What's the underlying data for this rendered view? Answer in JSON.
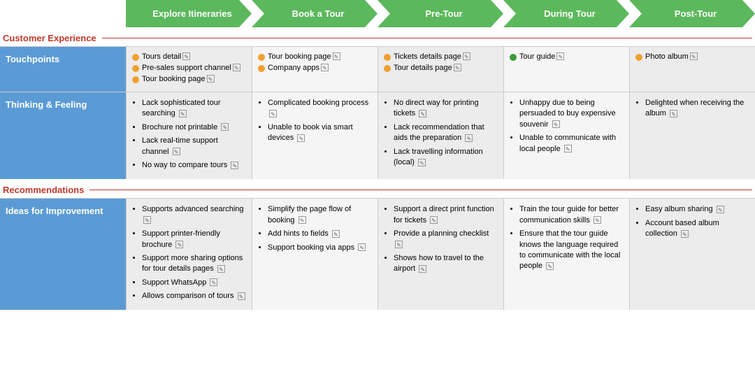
{
  "header": {
    "phases": [
      {
        "label": "Explore Itineraries"
      },
      {
        "label": "Book a Tour"
      },
      {
        "label": "Pre-Tour"
      },
      {
        "label": "During Tour"
      },
      {
        "label": "Post-Tour"
      }
    ]
  },
  "sections": {
    "customer_experience_label": "Customer Experience",
    "recommendations_label": "Recommendations"
  },
  "rows": [
    {
      "id": "touchpoints",
      "header": "Touchpoints",
      "cells": [
        {
          "type": "dots",
          "items": [
            {
              "color": "orange",
              "text": "Tours detail"
            },
            {
              "color": "orange",
              "text": "Pre-sales support channel"
            },
            {
              "color": "orange",
              "text": "Tour booking page"
            }
          ]
        },
        {
          "type": "dots",
          "items": [
            {
              "color": "orange",
              "text": "Tour booking page"
            },
            {
              "color": "orange",
              "text": "Company apps"
            }
          ]
        },
        {
          "type": "dots",
          "items": [
            {
              "color": "orange",
              "text": "Tickets details page"
            },
            {
              "color": "orange",
              "text": "Tour details page"
            }
          ]
        },
        {
          "type": "dots",
          "items": [
            {
              "color": "green",
              "text": "Tour guide"
            }
          ]
        },
        {
          "type": "dots",
          "items": [
            {
              "color": "orange",
              "text": "Photo album"
            }
          ]
        }
      ]
    },
    {
      "id": "thinking-feeling",
      "header": "Thinking & Feeling",
      "cells": [
        {
          "type": "bullets",
          "items": [
            "Lack sophisticated tour searching",
            "Brochure not printable",
            "Lack real-time support channel",
            "No way to compare tours"
          ]
        },
        {
          "type": "bullets",
          "items": [
            "Complicated booking process",
            "Unable to book via smart devices"
          ]
        },
        {
          "type": "bullets",
          "items": [
            "No direct way for printing tickets",
            "Lack recommendation that aids the preparation",
            "Lack travelling information (local)"
          ]
        },
        {
          "type": "bullets",
          "items": [
            "Unhappy due to being persuaded to buy expensive souvenir",
            "Unable to communicate with local people"
          ]
        },
        {
          "type": "bullets",
          "items": [
            "Delighted when receiving the album"
          ]
        }
      ]
    },
    {
      "id": "ideas",
      "header": "Ideas for Improvement",
      "cells": [
        {
          "type": "bullets",
          "items": [
            "Supports advanced searching",
            "Support printer-friendly brochure",
            "Support more sharing options for tour details pages",
            "Support WhatsApp",
            "Allows comparison of tours"
          ]
        },
        {
          "type": "bullets",
          "items": [
            "Simplify the page flow of booking",
            "Add hints to fields",
            "Support booking via apps"
          ]
        },
        {
          "type": "bullets",
          "items": [
            "Support a direct print function for tickets",
            "Provide a planning checklist",
            "Shows how to travel to the airport"
          ]
        },
        {
          "type": "bullets",
          "items": [
            "Train the tour guide for better communication skills",
            "Ensure that the tour guide knows the language required to communicate with the local people"
          ]
        },
        {
          "type": "bullets",
          "items": [
            "Easy album sharing",
            "Account based album collection"
          ]
        }
      ]
    }
  ]
}
